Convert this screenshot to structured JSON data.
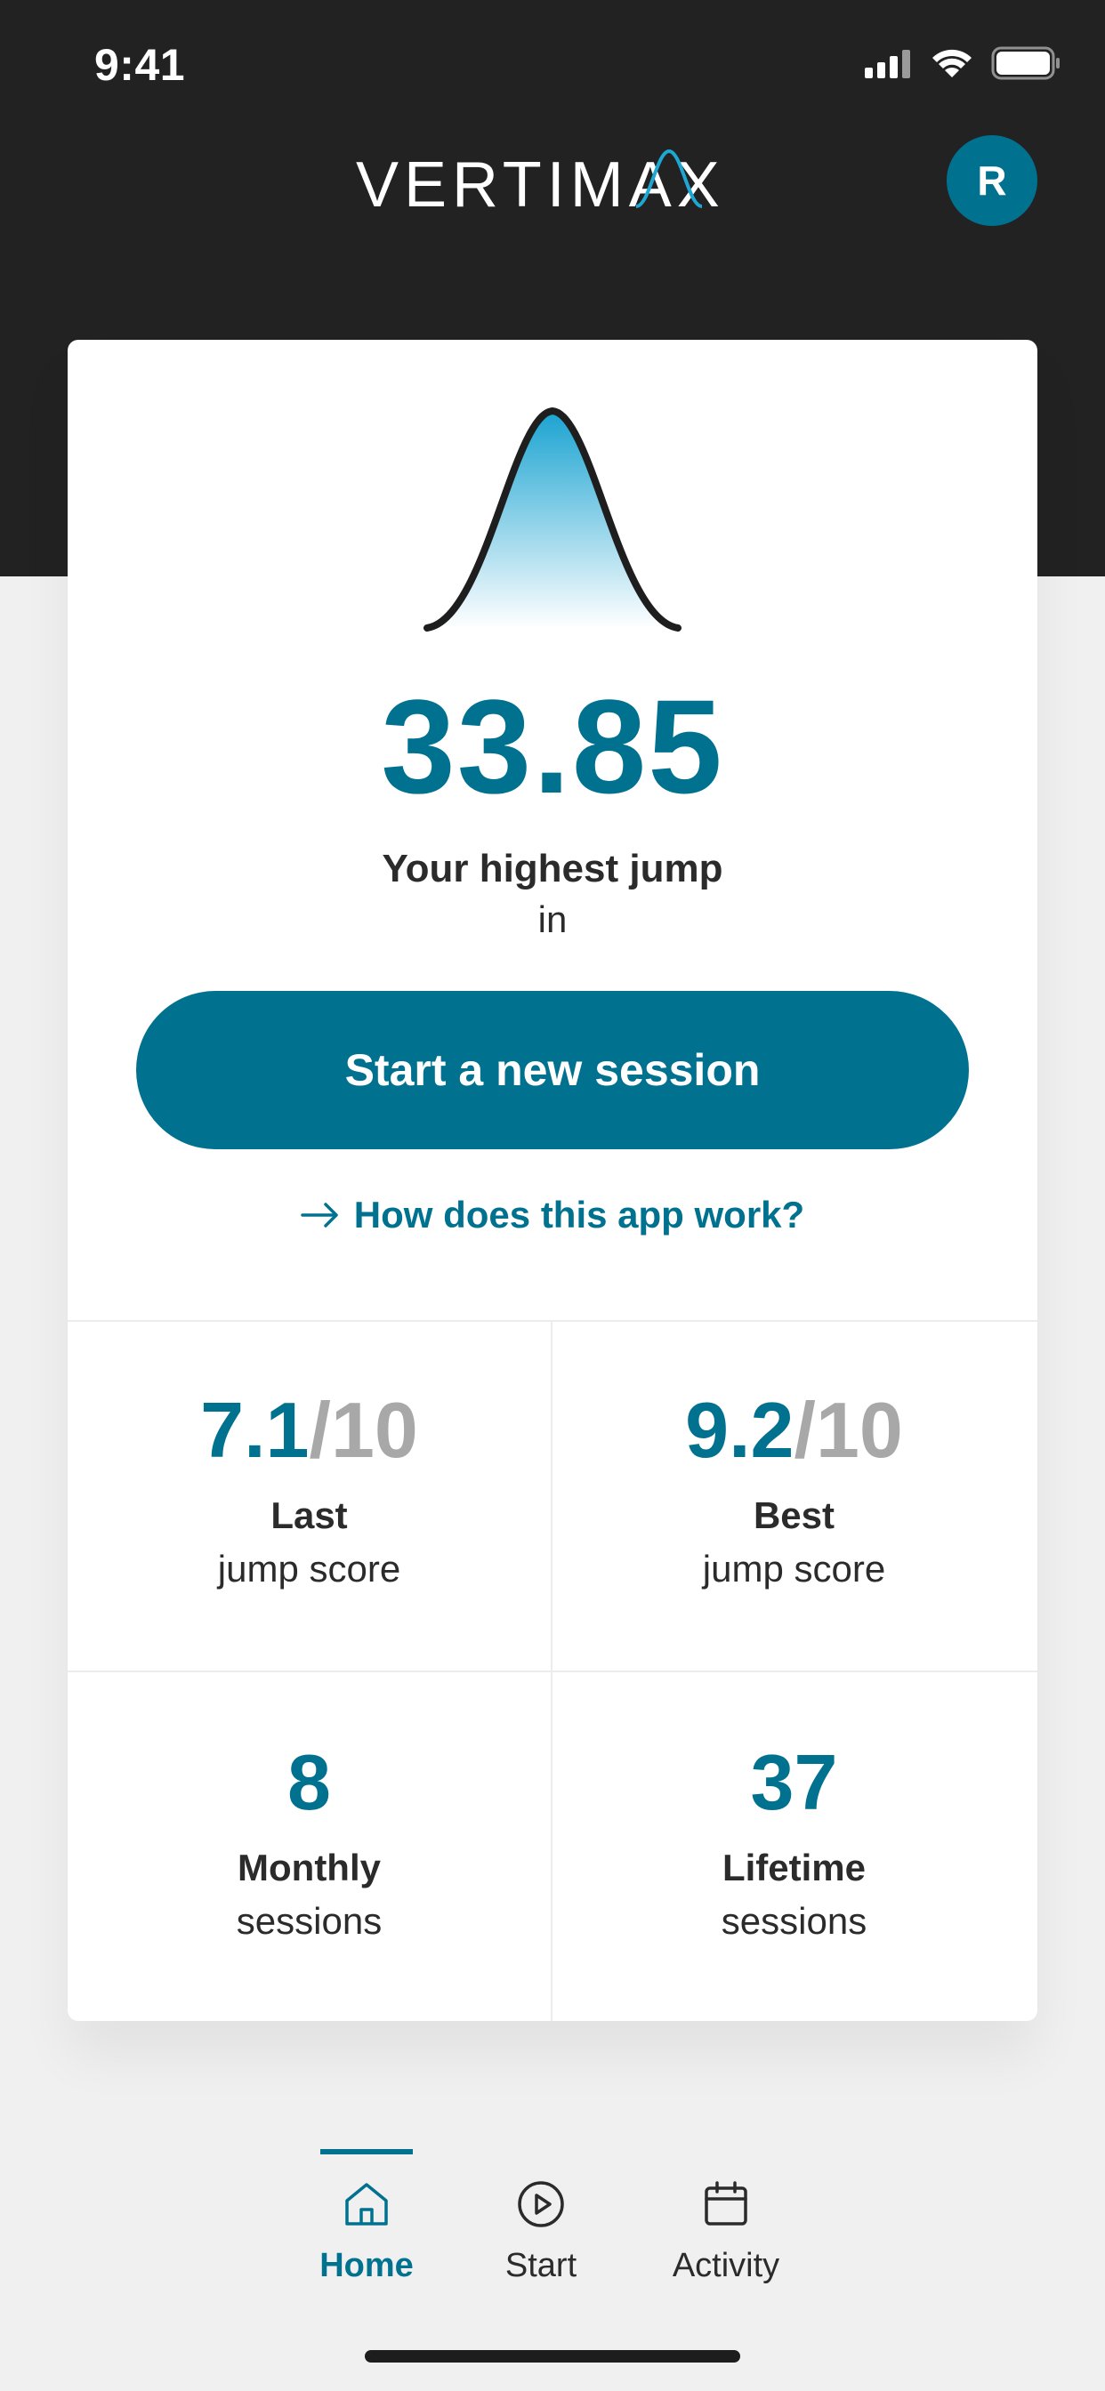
{
  "status_bar": {
    "time": "9:41"
  },
  "header": {
    "brand": "VERTIMAX",
    "avatar_initial": "R"
  },
  "hero": {
    "highest_value": "33.85",
    "highest_label": "Your highest jump",
    "highest_unit": "in",
    "cta_label": "Start a new session",
    "help_link": "How does this app work?"
  },
  "stats": [
    {
      "value": "7.1",
      "denominator": "/10",
      "line1": "Last",
      "line2": "jump score"
    },
    {
      "value": "9.2",
      "denominator": "/10",
      "line1": "Best",
      "line2": "jump score"
    },
    {
      "value": "8",
      "denominator": "",
      "line1": "Monthly",
      "line2": "sessions"
    },
    {
      "value": "37",
      "denominator": "",
      "line1": "Lifetime",
      "line2": "sessions"
    }
  ],
  "tabs": [
    {
      "label": "Home",
      "icon": "home-icon",
      "active": true
    },
    {
      "label": "Start",
      "icon": "play-circle-icon",
      "active": false
    },
    {
      "label": "Activity",
      "icon": "calendar-icon",
      "active": false
    }
  ],
  "colors": {
    "accent": "#00718f",
    "header_bg": "#222222",
    "page_bg": "#f0f0f0"
  }
}
